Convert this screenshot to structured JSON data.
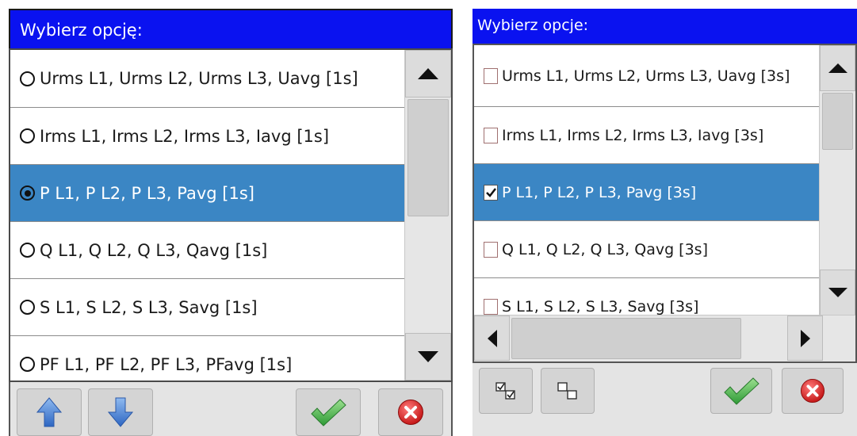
{
  "left": {
    "title": "Wybierz opcję:",
    "items": [
      {
        "label": "Urms L1, Urms L2, Urms L3, Uavg [1s]",
        "selected": false
      },
      {
        "label": "Irms L1, Irms L2, Irms L3, Iavg [1s]",
        "selected": false
      },
      {
        "label": "P L1, P L2, P L3, Pavg [1s]",
        "selected": true
      },
      {
        "label": "Q L1, Q L2, Q L3, Qavg [1s]",
        "selected": false
      },
      {
        "label": "S L1, S L2, S L3, Savg [1s]",
        "selected": false
      },
      {
        "label": "PF L1, PF L2, PF L3, PFavg [1s]",
        "selected": false
      }
    ],
    "toolbar": [
      "move-up-icon",
      "move-down-icon",
      "confirm-icon",
      "cancel-icon"
    ]
  },
  "right": {
    "title": "Wybierz opcje:",
    "items": [
      {
        "label": "Urms L1, Urms L2, Urms L3, Uavg [3s]",
        "checked": false
      },
      {
        "label": "Irms L1, Irms L2, Irms L3, Iavg [3s]",
        "checked": false
      },
      {
        "label": "P L1, P L2, P L3, Pavg [3s]",
        "checked": true
      },
      {
        "label": "Q L1, Q L2, Q L3, Qavg [3s]",
        "checked": false
      },
      {
        "label": "S L1, S L2, S L3, Savg [3s]",
        "checked": false
      }
    ],
    "toolbar": [
      "select-all-icon",
      "deselect-all-icon",
      "confirm-icon",
      "cancel-icon"
    ]
  },
  "colors": {
    "title_bar": "#0a12f0",
    "selected_row": "#3b86c4",
    "confirm": "#3cb043",
    "cancel": "#d81e1e",
    "arrow": "#3c78c8"
  }
}
